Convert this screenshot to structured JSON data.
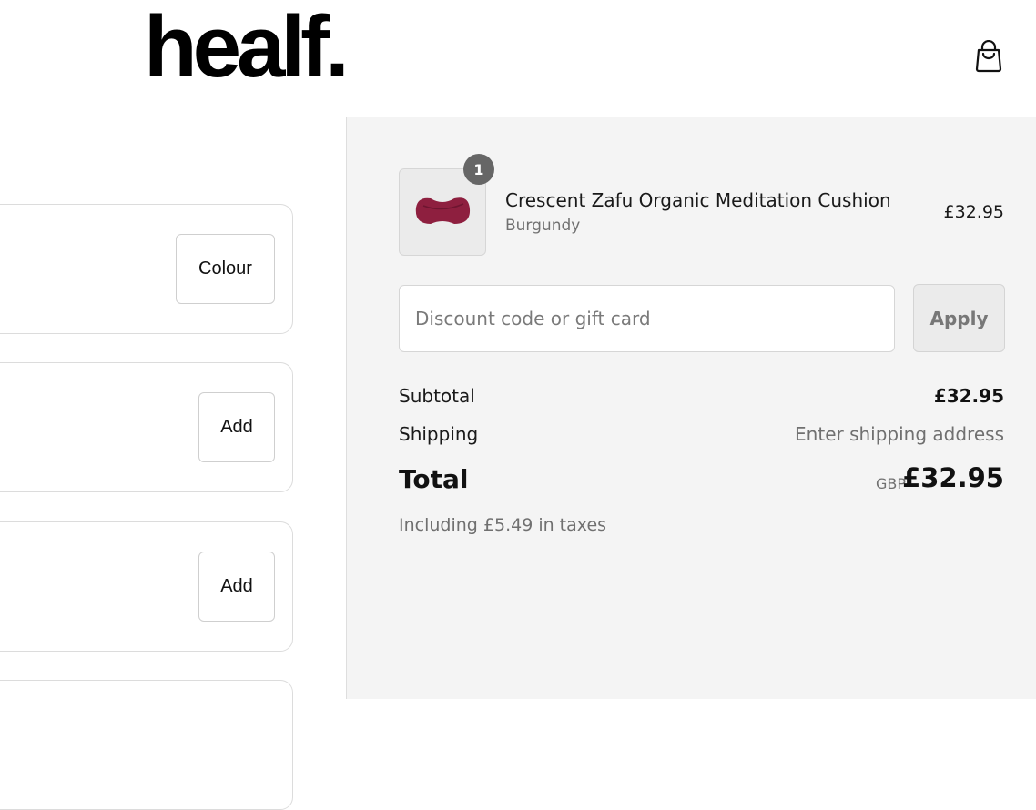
{
  "header": {
    "logo": "healf.",
    "bag_icon": "shopping-bag-icon"
  },
  "left": {
    "cards": [
      {
        "button_label": "Colour"
      },
      {
        "button_label": "Add"
      },
      {
        "button_label": "Add"
      }
    ]
  },
  "summary": {
    "item": {
      "quantity": "1",
      "name": "Crescent Zafu Organic Meditation Cushion",
      "variant": "Burgundy",
      "price": "£32.95",
      "image_color": "#8e1f3f"
    },
    "discount": {
      "placeholder": "Discount code or gift card",
      "value": "",
      "apply_label": "Apply"
    },
    "subtotal_label": "Subtotal",
    "subtotal_value": "£32.95",
    "shipping_label": "Shipping",
    "shipping_value": "Enter shipping address",
    "total_label": "Total",
    "currency": "GBP",
    "total_value": "£32.95",
    "taxes": "Including £5.49 in taxes"
  }
}
